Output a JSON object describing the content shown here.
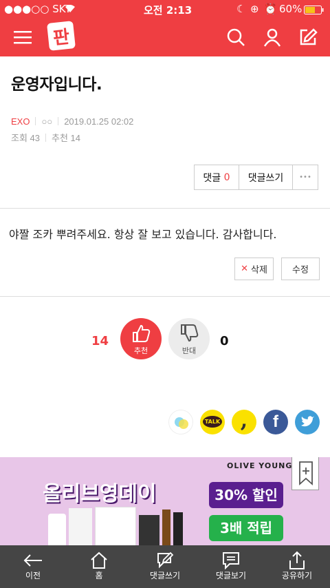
{
  "status": {
    "carrier": "●●●○○ SKT",
    "time": "오전 2:13",
    "battery": "60%"
  },
  "nav": {
    "logo": "판"
  },
  "post": {
    "title": "운영자입니다.",
    "category": "EXO",
    "author": "○○",
    "date": "2019.01.25 02:02",
    "views": "조회 43",
    "recommends": "추천 14"
  },
  "actions": {
    "comment_label": "댓글",
    "comment_count": "0",
    "write_comment": "댓글쓰기",
    "more": "•••"
  },
  "comment": {
    "text": "야짤 조카 뿌려주세요. 항상 잘 보고 있습니다. 감사합니다.",
    "delete_label": "삭제",
    "edit_label": "수정"
  },
  "votes": {
    "up_count": "14",
    "up_label": "추천",
    "down_label": "반대",
    "down_count": "0"
  },
  "share": {
    "talk_label": "TALK"
  },
  "ad": {
    "brand": "OLIVE YOUNG",
    "headline": "올리브영데이",
    "discount": "30% 할인",
    "points": "3배 적립"
  },
  "bottom": [
    {
      "label": "이전"
    },
    {
      "label": "홈"
    },
    {
      "label": "댓글쓰기"
    },
    {
      "label": "댓글보기"
    },
    {
      "label": "공유하기"
    }
  ]
}
